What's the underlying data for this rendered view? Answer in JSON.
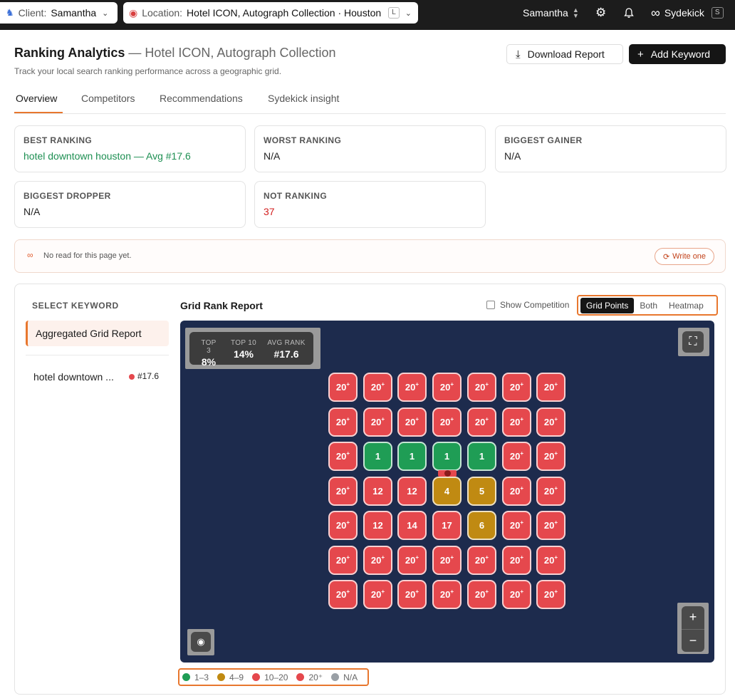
{
  "topbar": {
    "client_label": "Client:",
    "client_value": "Samantha",
    "location_label": "Location:",
    "location_value": "Hotel ICON, Autograph Collection · Houston",
    "location_kbd": "L",
    "user": "Samantha",
    "sydekick_label": "Sydekick",
    "sydekick_kbd": "S"
  },
  "header": {
    "title": "Ranking Analytics",
    "title_sub": "— Hotel ICON, Autograph Collection",
    "subtitle": "Track your local search ranking performance across a geographic grid.",
    "download_label": "Download Report",
    "add_label": "Add Keyword"
  },
  "tabs": [
    "Overview",
    "Competitors",
    "Recommendations",
    "Sydekick insight"
  ],
  "cards": [
    {
      "label": "BEST RANKING",
      "value": "hotel downtown houston — Avg #17.6"
    },
    {
      "label": "WORST RANKING",
      "value": "N/A"
    },
    {
      "label": "BIGGEST GAINER",
      "value": "N/A"
    },
    {
      "label": "BIGGEST DROPPER",
      "value": "N/A"
    },
    {
      "label": "NOT RANKING",
      "value": "37"
    }
  ],
  "note": {
    "text": "No read for this page yet.",
    "button": "Write one"
  },
  "keywords": {
    "heading": "SELECT KEYWORD",
    "aggregated": "Aggregated Grid Report",
    "item_label": "hotel downtown ...",
    "item_rank": "#17.6"
  },
  "report": {
    "title": "Grid Rank Report",
    "show_competition": "Show Competition",
    "views": [
      "Grid Points",
      "Both",
      "Heatmap"
    ],
    "selected_view": "Grid Points",
    "stats": [
      {
        "label": "TOP 3",
        "value": "8%"
      },
      {
        "label": "TOP 10",
        "value": "14%"
      },
      {
        "label": "AVG RANK",
        "value": "#17.6"
      }
    ]
  },
  "grid": [
    [
      "20+",
      "20+",
      "20+",
      "20+",
      "20+",
      "20+",
      "20+"
    ],
    [
      "20+",
      "20+",
      "20+",
      "20+",
      "20+",
      "20+",
      "20+"
    ],
    [
      "20+",
      "1",
      "1",
      "1",
      "1",
      "20+",
      "20+"
    ],
    [
      "20+",
      "12",
      "12",
      "4",
      "5",
      "20+",
      "20+"
    ],
    [
      "20+",
      "12",
      "14",
      "17",
      "6",
      "20+",
      "20+"
    ],
    [
      "20+",
      "20+",
      "20+",
      "20+",
      "20+",
      "20+",
      "20+"
    ],
    [
      "20+",
      "20+",
      "20+",
      "20+",
      "20+",
      "20+",
      "20+"
    ]
  ],
  "legend": [
    {
      "label": "1–3",
      "color": "#1f9d55"
    },
    {
      "label": "4–9",
      "color": "#c08a12"
    },
    {
      "label": "10–20",
      "color": "#e5484d"
    },
    {
      "label": "20⁺",
      "color": "#e5484d"
    },
    {
      "label": "N/A",
      "color": "#9aa0a6"
    }
  ]
}
